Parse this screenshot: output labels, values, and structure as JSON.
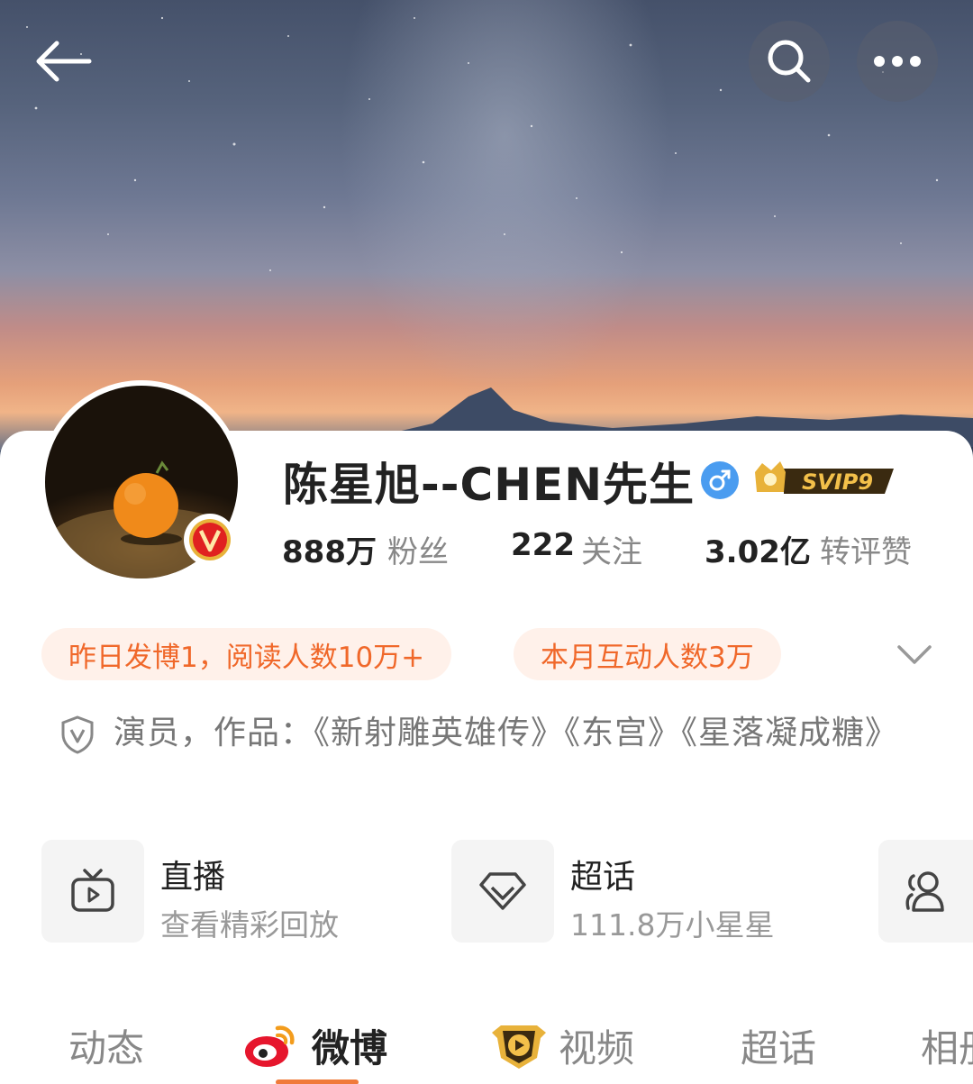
{
  "header": {
    "back_icon": "back-arrow-icon",
    "search_icon": "search-icon",
    "more_icon": "more-dots-icon"
  },
  "profile": {
    "name": "陈星旭--CHEN先生",
    "gender_icon": "male-icon",
    "vip_label": "SVIP9",
    "verify_icon": "verified-v-icon"
  },
  "stats": [
    {
      "value": "888万",
      "label": "粉丝"
    },
    {
      "value": "222",
      "label": "关注"
    },
    {
      "value": "3.02亿",
      "label": "转评赞"
    }
  ],
  "pills": [
    {
      "text": "昨日发博1，阅读人数10万+"
    },
    {
      "text": "本月互动人数3万"
    }
  ],
  "bio": {
    "text": "演员，作品：《新射雕英雄传》《东宫》《星落凝成糖》"
  },
  "tiles": [
    {
      "icon": "tv-icon",
      "title": "直播",
      "subtitle": "查看精彩回放"
    },
    {
      "icon": "diamond-icon",
      "title": "超话",
      "subtitle": "111.8万小星星"
    },
    {
      "icon": "users-icon"
    }
  ],
  "tabs": [
    {
      "label": "动态",
      "active": false
    },
    {
      "label": "微博",
      "active": true
    },
    {
      "label": "视频",
      "active": false
    },
    {
      "label": "超话",
      "active": false
    },
    {
      "label": "相册",
      "active": false
    }
  ],
  "colors": {
    "accent": "#f0682a",
    "pill_bg": "#fff1ea",
    "gender": "#4a9cf0",
    "verify_red": "#e02020",
    "vip_gold": "#e8b23a"
  }
}
